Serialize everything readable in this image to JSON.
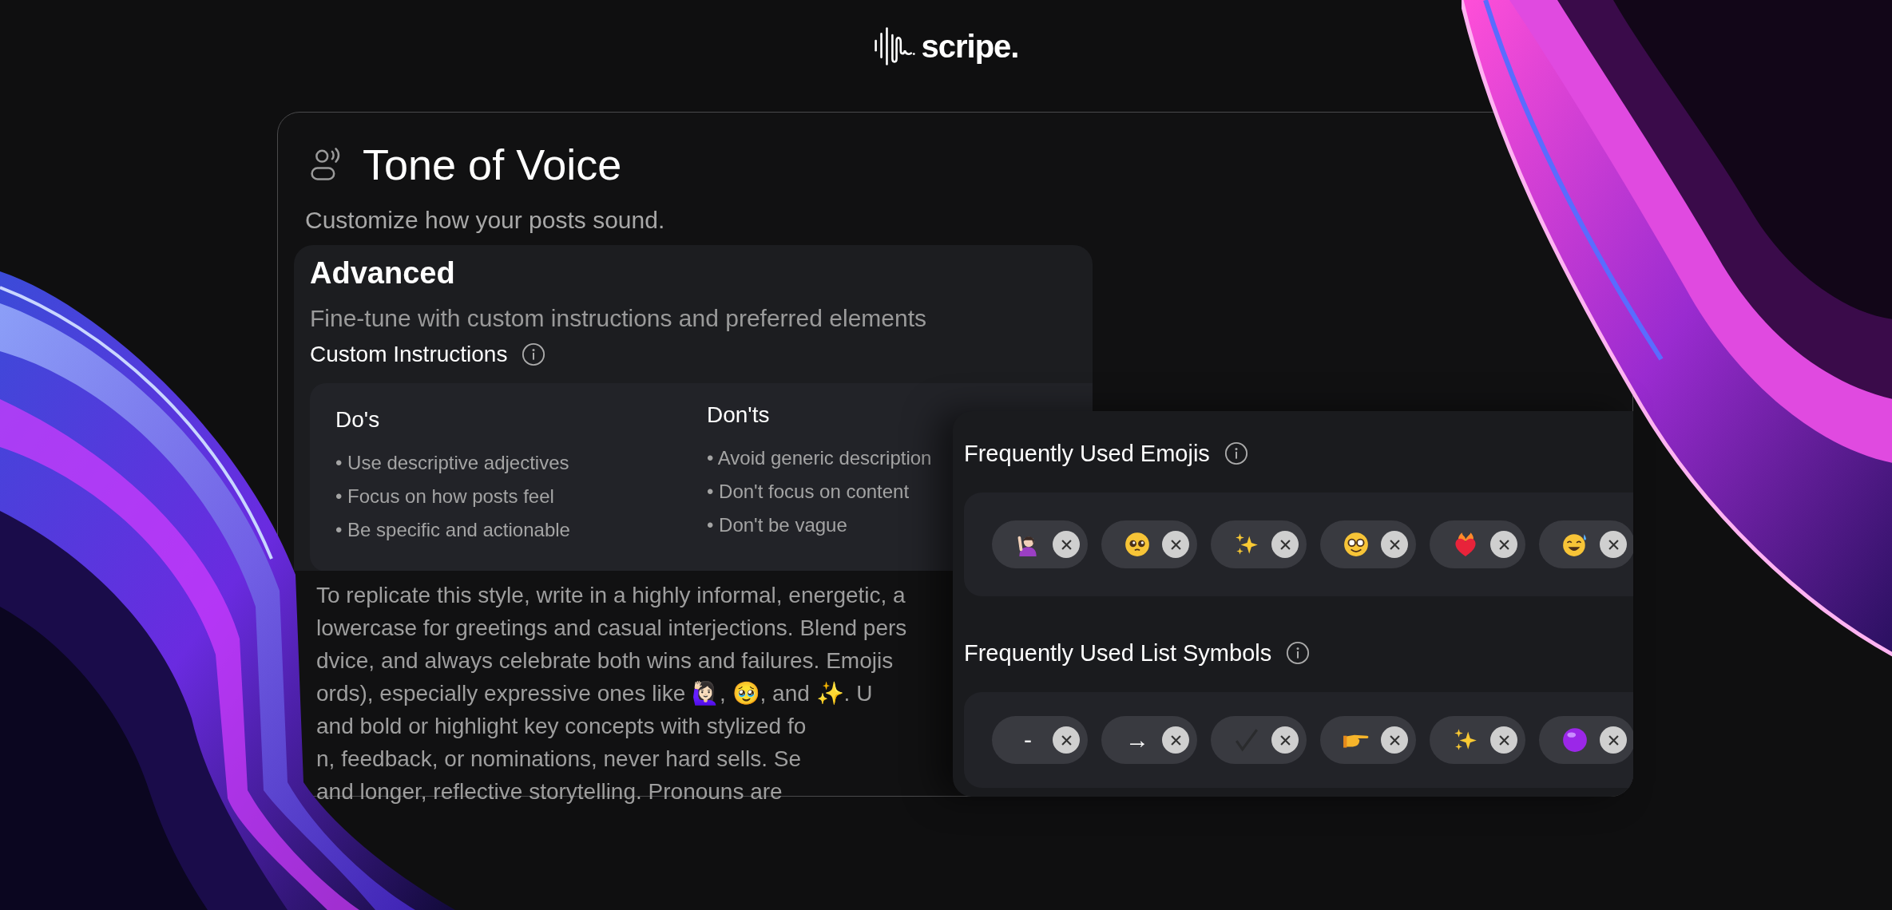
{
  "logo": {
    "wordmark": "scripe."
  },
  "header": {
    "title": "Tone of Voice",
    "subtitle": "Customize how your posts sound."
  },
  "advanced": {
    "title": "Advanced",
    "description": "Fine-tune with custom instructions and preferred elements",
    "custom_instructions": {
      "label": "Custom Instructions",
      "columns": [
        {
          "title": "Do's",
          "items": [
            "• Use descriptive adjectives",
            "• Focus on how posts feel",
            "• Be specific and actionable"
          ]
        },
        {
          "title": "Don'ts",
          "items": [
            "• Avoid generic description",
            "• Don't focus on content",
            "• Don't be vague"
          ]
        }
      ]
    },
    "instructions_text": [
      "To replicate this style, write in a highly informal, energetic, a",
      "lowercase for greetings and casual interjections. Blend pers",
      "dvice, and always celebrate both wins and failures. Emojis",
      "ords), especially expressive ones like 🙋🏻‍♀️, 🥹, and ✨. U",
      "and bold or highlight key concepts with stylized fo",
      "n, feedback, or nominations, never hard sells. Se",
      "and longer, reflective storytelling. Pronouns are"
    ]
  },
  "emojis": {
    "title": "Frequently Used Emojis",
    "chips": [
      {
        "kind": "raising-hand"
      },
      {
        "kind": "teary-face"
      },
      {
        "kind": "sparkles"
      },
      {
        "kind": "glasses-face"
      },
      {
        "kind": "flaming-heart"
      },
      {
        "kind": "sweat-smile"
      }
    ]
  },
  "list_symbols": {
    "title": "Frequently Used List Symbols",
    "chips": [
      {
        "kind": "text",
        "text": "-"
      },
      {
        "kind": "text",
        "text": "→"
      },
      {
        "kind": "check"
      },
      {
        "kind": "pointing-hand"
      },
      {
        "kind": "sparkles"
      },
      {
        "kind": "purple-circle"
      }
    ]
  }
}
